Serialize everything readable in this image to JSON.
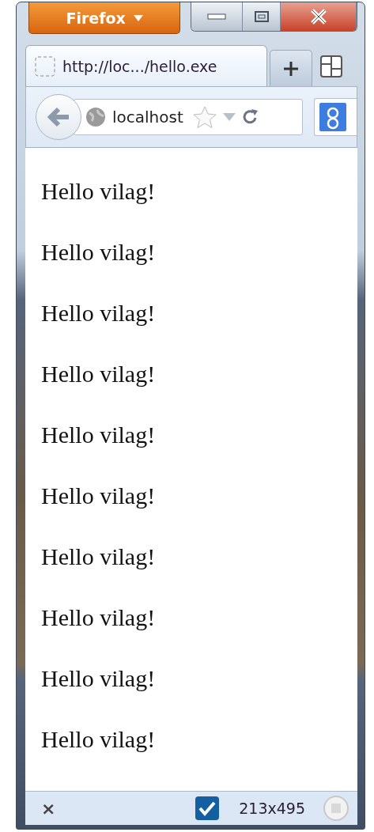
{
  "firefox_button": {
    "label": "Firefox"
  },
  "tab": {
    "title": "http://loc.../hello.exe",
    "selected": true
  },
  "address_bar": {
    "value": "localhost"
  },
  "content": {
    "lines": [
      "Hello vilag!",
      "Hello vilag!",
      "Hello vilag!",
      "Hello vilag!",
      "Hello vilag!",
      "Hello vilag!",
      "Hello vilag!",
      "Hello vilag!",
      "Hello vilag!",
      "Hello vilag!"
    ]
  },
  "status_bar": {
    "close": "×",
    "checked": true,
    "size": "213x495"
  }
}
